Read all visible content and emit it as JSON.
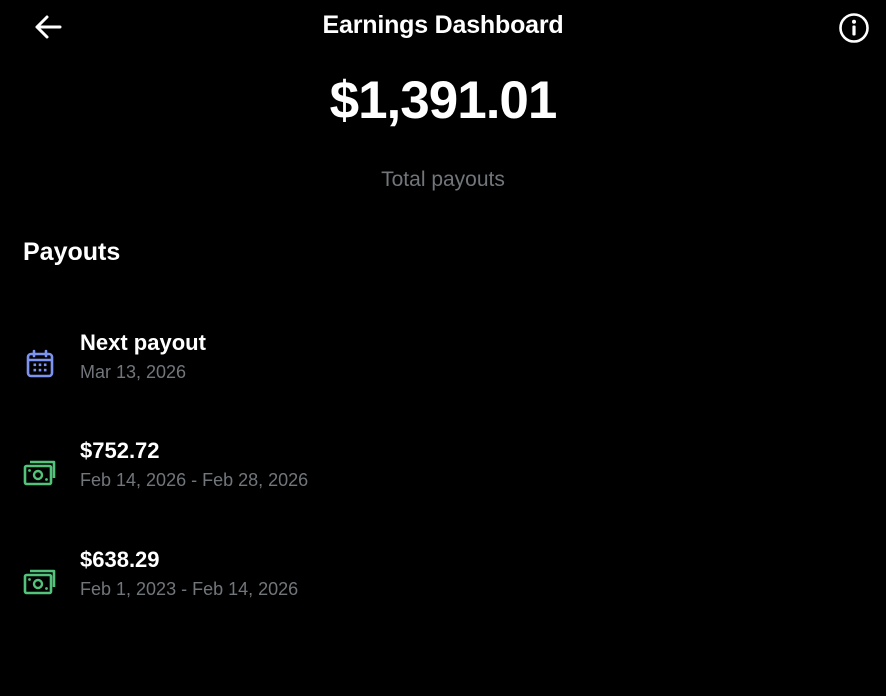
{
  "header": {
    "title": "Earnings Dashboard",
    "back_icon": "arrow-left-icon",
    "info_icon": "info-circle-icon"
  },
  "summary": {
    "total_amount": "$1,391.01",
    "total_label": "Total payouts"
  },
  "payouts": {
    "section_title": "Payouts",
    "items": [
      {
        "icon": "calendar-icon",
        "title": "Next payout",
        "subtitle": "Mar 13, 2026"
      },
      {
        "icon": "money-icon",
        "title": "$752.72",
        "subtitle": "Feb 14, 2026 - Feb 28, 2026"
      },
      {
        "icon": "money-icon",
        "title": "$638.29",
        "subtitle": "Feb 1, 2023 - Feb 14, 2026"
      }
    ]
  },
  "colors": {
    "background": "#000000",
    "text_primary": "#ffffff",
    "text_secondary": "#71767b",
    "calendar_icon": "#7d93f0",
    "money_icon": "#53c27a"
  }
}
